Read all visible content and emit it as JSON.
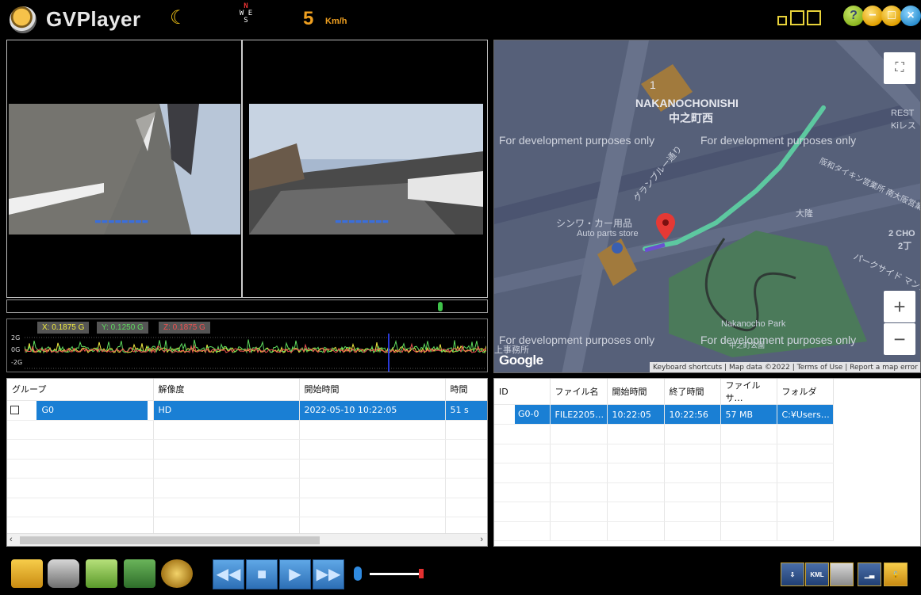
{
  "header": {
    "app_title": "GVPlayer",
    "night_mode_icon": "moon-icon",
    "compass": {
      "n": "N",
      "s": "S",
      "e": "E",
      "w": "W"
    },
    "speed_value": "5",
    "speed_unit": "Km/h",
    "window_buttons": [
      "help",
      "minimize",
      "maximize",
      "close"
    ]
  },
  "gsensor": {
    "x_label": "X: 0.1875 G",
    "y_label": "Y: 0.1250 G",
    "z_label": "Z: 0.1875 G",
    "scale_top": "2G",
    "scale_mid": "0G",
    "scale_bottom": "-2G",
    "colors": {
      "x": "#f0ea40",
      "y": "#5edc5e",
      "z": "#f05252"
    }
  },
  "map": {
    "area_name_en": "NAKANOCHONISHI",
    "area_name_jp": "中之町西",
    "dev_watermark": "For development purposes only",
    "place_shop": "シンワ・カー用品",
    "place_shop_en": "Auto parts store",
    "street": "グランブルー通り",
    "street2": "パークサイド マンション",
    "park": "Nakanocho Park",
    "park_jp": "中之町公園",
    "building": "阪和タイキン営業所 南大阪営業所",
    "chome": "2 CHO",
    "chome2": "2丁",
    "rest": "REST",
    "rest2": "Kiレス",
    "office": "上事務所",
    "block": "1",
    "kaisha": "大隆",
    "brand": "Google",
    "footer": [
      "Keyboard shortcuts",
      "Map data ©2022",
      "Terms of Use",
      "Report a map error"
    ],
    "zoom_in": "+",
    "zoom_out": "−"
  },
  "groups_table": {
    "columns": [
      "グループ",
      "解像度",
      "開始時間",
      "時間"
    ],
    "rows": [
      {
        "group": "G0",
        "resolution": "HD",
        "start": "2022-05-10 10:22:05",
        "duration": "51 s"
      }
    ]
  },
  "files_table": {
    "columns": [
      "ID",
      "ファイル名",
      "開始時間",
      "終了時間",
      "ファイルサ…",
      "フォルダ"
    ],
    "rows": [
      {
        "id": "G0-0",
        "filename": "FILE2205…",
        "start": "10:22:05",
        "end": "10:22:56",
        "size": "57 MB",
        "folder": "C:¥Users…"
      }
    ]
  },
  "toolbar": {
    "kml_label": "KML"
  }
}
